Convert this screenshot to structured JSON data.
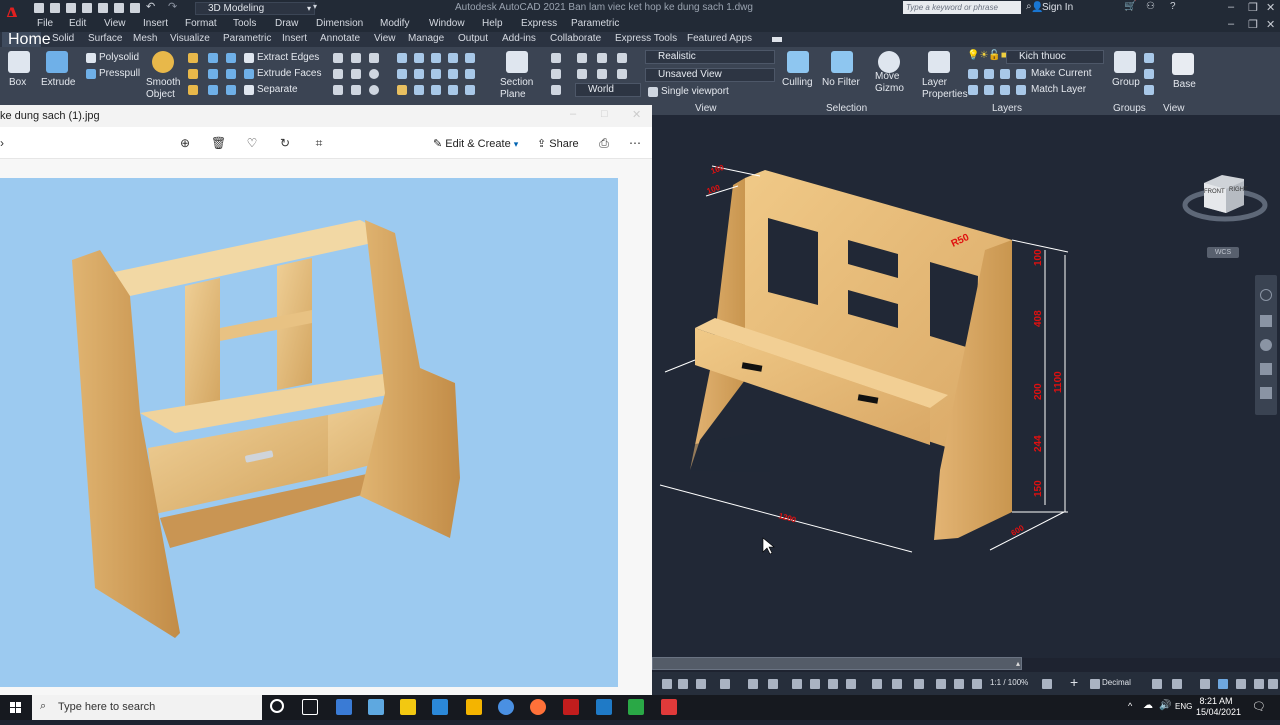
{
  "acad": {
    "logo_letter": "A",
    "workspace": "3D Modeling",
    "title": "Autodesk AutoCAD 2021    Ban lam viec ket hop ke dung sach 1.dwg",
    "search_placeholder": "Type a keyword or phrase",
    "sign_in": "Sign In",
    "menu": [
      "File",
      "Edit",
      "View",
      "Insert",
      "Format",
      "Tools",
      "Draw",
      "Dimension",
      "Modify",
      "Window",
      "Help",
      "Express",
      "Parametric"
    ],
    "tabs": [
      "Home",
      "Solid",
      "Surface",
      "Mesh",
      "Visualize",
      "Parametric",
      "Insert",
      "Annotate",
      "View",
      "Manage",
      "Output",
      "Add-ins",
      "Collaborate",
      "Express Tools",
      "Featured Apps"
    ],
    "ribbon": {
      "box": "Box",
      "extrude": "Extrude",
      "polysolid": "Polysolid",
      "presspull": "Presspull",
      "smooth_object": "Smooth Object",
      "extract_edges": "Extract Edges",
      "extrude_faces": "Extrude Faces",
      "separate": "Separate",
      "section_plane": "Section Plane",
      "world": "World",
      "visual_style": "Realistic",
      "saved_view": "Unsaved View",
      "viewport_config": "Single viewport",
      "culling": "Culling",
      "no_filter": "No Filter",
      "move_gizmo": "Move Gizmo",
      "layer_properties": "Layer Properties",
      "layer_name": "Kich thuoc",
      "make_current": "Make Current",
      "match_layer": "Match Layer",
      "group": "Group",
      "base": "Base",
      "panel_view": "View",
      "panel_selection": "Selection",
      "panel_layers": "Layers",
      "panel_groups": "Groups",
      "panel_view2": "View"
    },
    "viewcube": {
      "front": "FRONT",
      "right": "RIGHT",
      "wcs": "WCS"
    },
    "dims": {
      "radius": "R50",
      "d1": "100",
      "d2": "408",
      "d3": "200",
      "d4": "244",
      "d5": "150",
      "total": "1100",
      "width": "1200",
      "depth": "600",
      "top1": "160",
      "top2": "100"
    },
    "status": {
      "scale": "1:1 / 100%",
      "units": "Decimal"
    }
  },
  "photos": {
    "title": "ke dung sach (1).jpg",
    "edit_create": "Edit & Create",
    "share": "Share"
  },
  "taskbar": {
    "search_placeholder": "Type here to search",
    "lang": "ENG",
    "time": "8:21 AM",
    "date": "15/04/2021"
  }
}
